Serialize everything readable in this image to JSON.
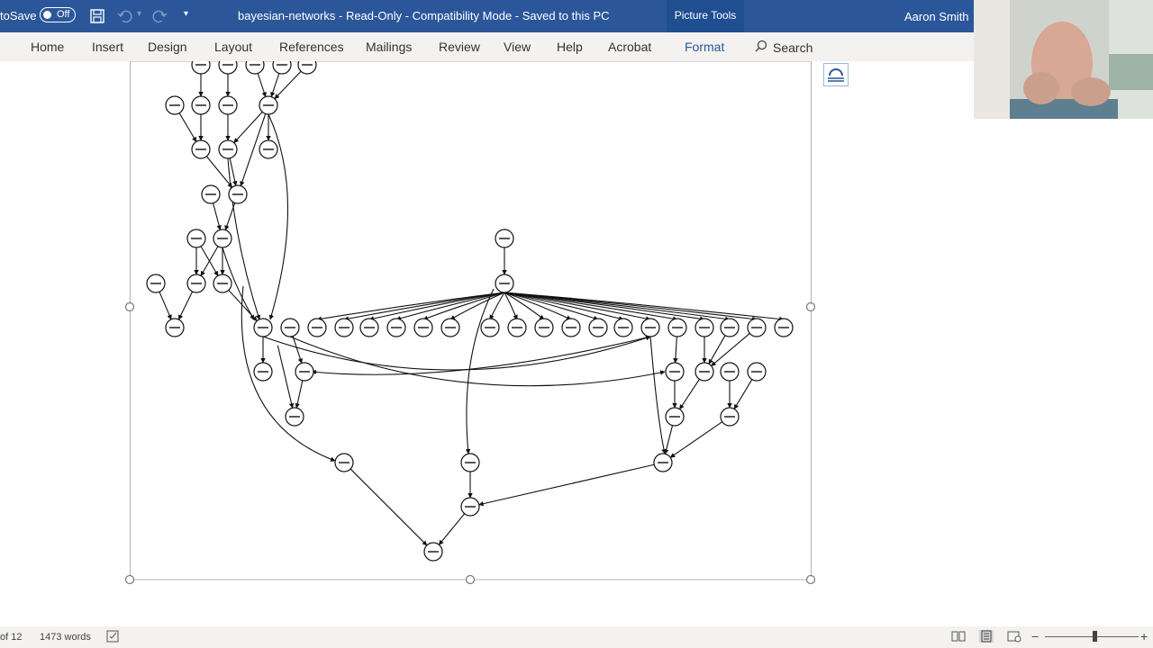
{
  "titlebar": {
    "autosave_label": "toSave",
    "autosave_state": "Off",
    "document_title": "bayesian-networks  -  Read-Only  -  Compatibility Mode  -  Saved to this PC",
    "contextual_tab": "Picture Tools",
    "user_name": "Aaron Smith",
    "color": "#2b579a"
  },
  "ribbon": {
    "tabs": [
      {
        "label": "Home"
      },
      {
        "label": "Insert"
      },
      {
        "label": "Design"
      },
      {
        "label": "Layout"
      },
      {
        "label": "References"
      },
      {
        "label": "Mailings"
      },
      {
        "label": "Review"
      },
      {
        "label": "View"
      },
      {
        "label": "Help"
      },
      {
        "label": "Acrobat"
      },
      {
        "label": "Format"
      }
    ],
    "active_tab": "Format",
    "search_label": "Search"
  },
  "statusbar": {
    "page_info": "of 12",
    "word_count": "1473 words"
  },
  "icons": {
    "save": "save-icon",
    "undo": "undo-icon",
    "redo": "redo-icon",
    "customize": "customize-quick-access-icon",
    "search": "search-icon",
    "layout_options": "layout-options-icon",
    "proofing": "proofing-icon",
    "read_mode": "read-mode-icon",
    "print_layout": "print-layout-icon",
    "web_layout": "web-layout-icon"
  }
}
